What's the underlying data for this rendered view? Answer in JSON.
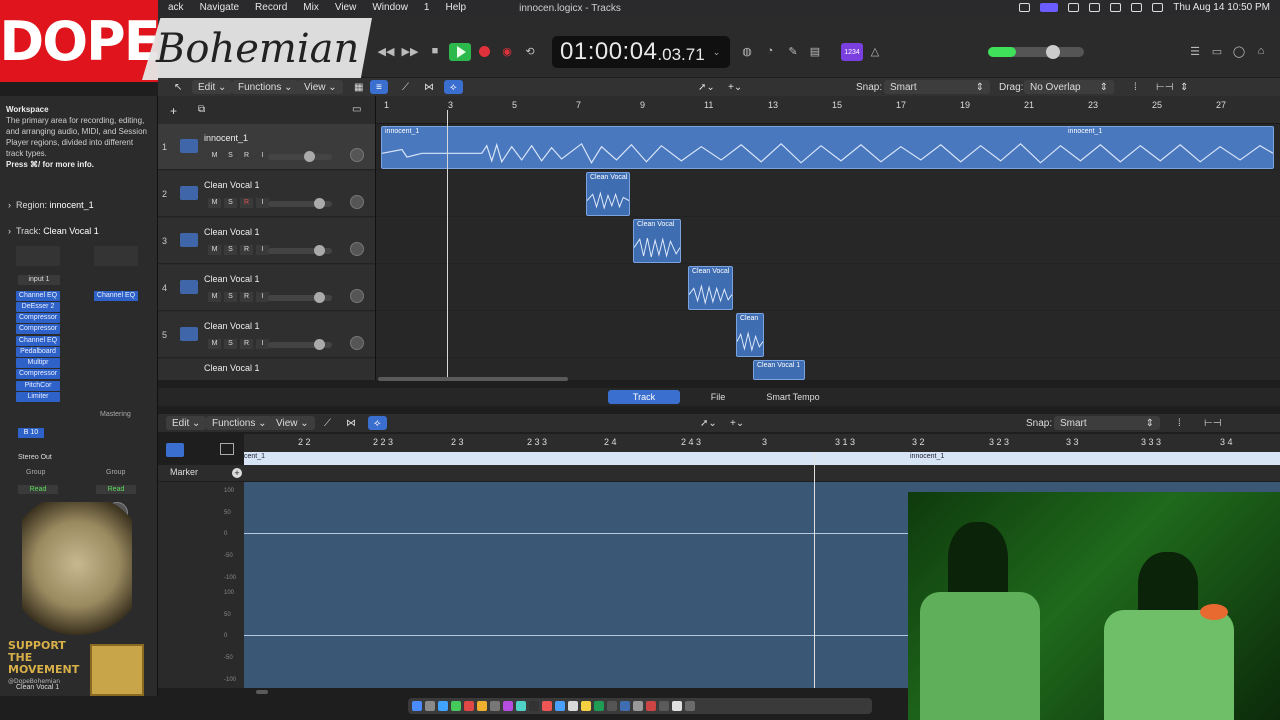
{
  "menubar": {
    "items": [
      "ack",
      "Navigate",
      "Record",
      "Mix",
      "View",
      "Window",
      "1",
      "Help"
    ],
    "datetime": "Thu Aug 14  10:50 PM"
  },
  "brand": {
    "dope": "DOPE",
    "bohemian": "Bohemian"
  },
  "window": {
    "title": "innocen.logicx - Tracks"
  },
  "lcd": {
    "time_main": "01:00:04",
    "time_sub": ".03.71"
  },
  "tempo_badge": "1234",
  "toolbar": {
    "edit": "Edit",
    "functions": "Functions",
    "view": "View",
    "snap_label": "Snap:",
    "snap_value": "Smart",
    "drag_label": "Drag:",
    "drag_value": "No Overlap"
  },
  "inspector": {
    "help_title": "Workspace",
    "help_text": "The primary area for recording, editing, and arranging audio, MIDI, and Session Player regions, divided into different track types.",
    "help_more": "Press ⌘/ for more info.",
    "region_label": "Region:",
    "region_value": "innocent_1",
    "track_label": "Track:",
    "track_value": "Clean Vocal 1",
    "input": "input 1",
    "plugins": [
      "Channel EQ",
      "DeEsser 2",
      "Compressor",
      "Compressor",
      "Channel EQ",
      "Pedalboard",
      "Multipr",
      "Compressor",
      "PitchCor",
      "Limiter"
    ],
    "plugins_right": [
      "Channel EQ"
    ],
    "mastering": "Mastering",
    "bus": "B 10",
    "output": "Stereo Out",
    "group": "Group",
    "read": "Read",
    "bottom_track": "Clean Vocal 1"
  },
  "tracks": [
    {
      "num": "1",
      "name": "innocent_1"
    },
    {
      "num": "2",
      "name": "Clean Vocal 1"
    },
    {
      "num": "3",
      "name": "Clean Vocal 1"
    },
    {
      "num": "4",
      "name": "Clean Vocal 1"
    },
    {
      "num": "5",
      "name": "Clean Vocal 1"
    },
    {
      "num": "",
      "name": "Clean Vocal 1"
    }
  ],
  "track_buttons": {
    "m": "M",
    "s": "S",
    "r": "R",
    "i": "I"
  },
  "ruler": [
    "1",
    "3",
    "5",
    "7",
    "9",
    "11",
    "13",
    "15",
    "17",
    "19",
    "21",
    "23",
    "25",
    "27"
  ],
  "regions": {
    "main": "innocent_1",
    "main_right": "innocent_1",
    "r2": "Clean Vocal",
    "r3": "Clean Vocal",
    "r4": "Clean Vocal",
    "r5": "Clean",
    "r6": "Clean Vocal 1"
  },
  "editor": {
    "tabs": [
      "Track",
      "File",
      "Smart Tempo"
    ],
    "edit": "Edit",
    "functions": "Functions",
    "view": "View",
    "snap_label": "Snap:",
    "snap_value": "Smart",
    "ruler": [
      "2 2",
      "2 2 3",
      "2 3",
      "2 3 3",
      "2 4",
      "2 4 3",
      "3",
      "3 1 3",
      "3 2",
      "3 2 3",
      "3 3",
      "3 3 3",
      "3 4"
    ],
    "region_left": "cent_1",
    "region_right": "innocent_1",
    "marker": "Marker",
    "scale": [
      "100",
      "50",
      "0",
      "-50",
      "-100",
      "100",
      "50",
      "0",
      "-50",
      "-100"
    ]
  },
  "overlay": {
    "support": "SUPPORT THE MOVEMENT",
    "handle": "@DopeBohemian"
  },
  "colors": {
    "region": "#3f6db2",
    "accent": "#3a6fd0",
    "play": "#2db84b",
    "record": "#e0323a",
    "brand_red": "#e0141c"
  }
}
